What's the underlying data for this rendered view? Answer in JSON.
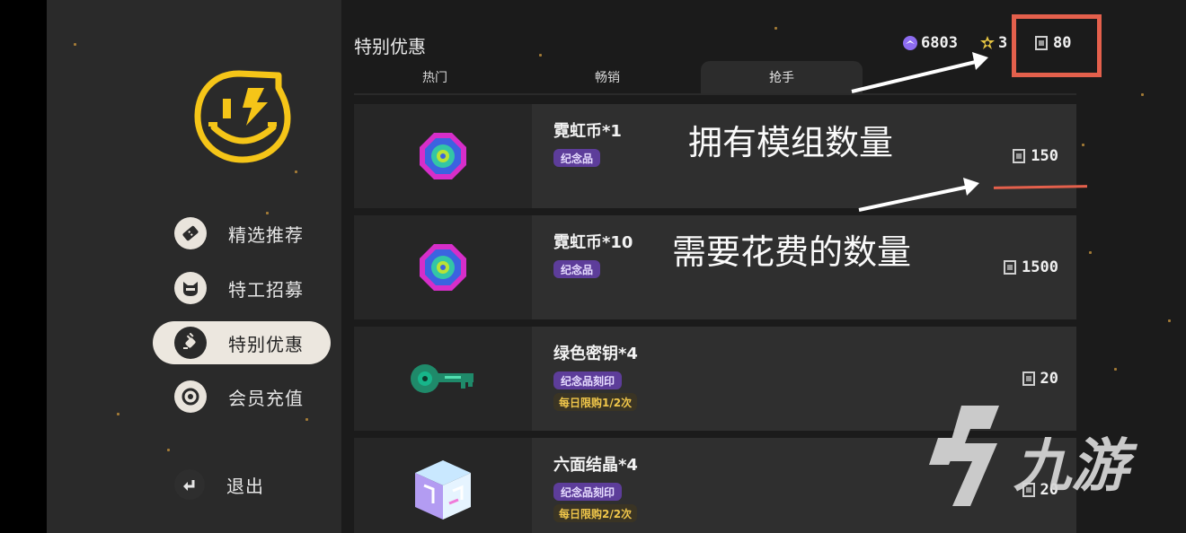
{
  "sidebar": {
    "items": [
      {
        "label": "精选推荐",
        "icon": "ticket-icon"
      },
      {
        "label": "特工招募",
        "icon": "agent-face-icon"
      },
      {
        "label": "特别优惠",
        "icon": "plug-icon",
        "active": true
      },
      {
        "label": "会员充值",
        "icon": "coin-target-icon"
      }
    ],
    "exit_label": "退出"
  },
  "header": {
    "title": "特别优惠",
    "currencies": [
      {
        "icon": "neon-coin-icon",
        "value": "6803"
      },
      {
        "icon": "gear-token-icon",
        "value": "3"
      },
      {
        "icon": "module-icon",
        "value": "80"
      }
    ]
  },
  "tabs": [
    {
      "label": "热门"
    },
    {
      "label": "畅销"
    },
    {
      "label": "抢手",
      "active": true
    }
  ],
  "items": [
    {
      "name": "霓虹币*1",
      "badge": "纪念品",
      "limit": "",
      "price": "150",
      "icon": "neon-coin-icon"
    },
    {
      "name": "霓虹币*10",
      "badge": "纪念品",
      "limit": "",
      "price": "1500",
      "icon": "neon-coin-icon"
    },
    {
      "name": "绿色密钥*4",
      "badge": "纪念品刻印",
      "limit": "每日限购1/2次",
      "price": "20",
      "icon": "green-key-icon"
    },
    {
      "name": "六面结晶*4",
      "badge": "纪念品刻印",
      "limit": "每日限购2/2次",
      "price": "20",
      "icon": "crystal-cube-icon"
    }
  ],
  "annotations": {
    "owned_label": "拥有模组数量",
    "cost_label": "需要花费的数量"
  },
  "watermark": {
    "text": "九游"
  },
  "colors": {
    "highlight": "#e4604c",
    "badge": "#5d3d9a",
    "limit_text": "#f0c64a",
    "logo_yellow": "#f5c518"
  }
}
